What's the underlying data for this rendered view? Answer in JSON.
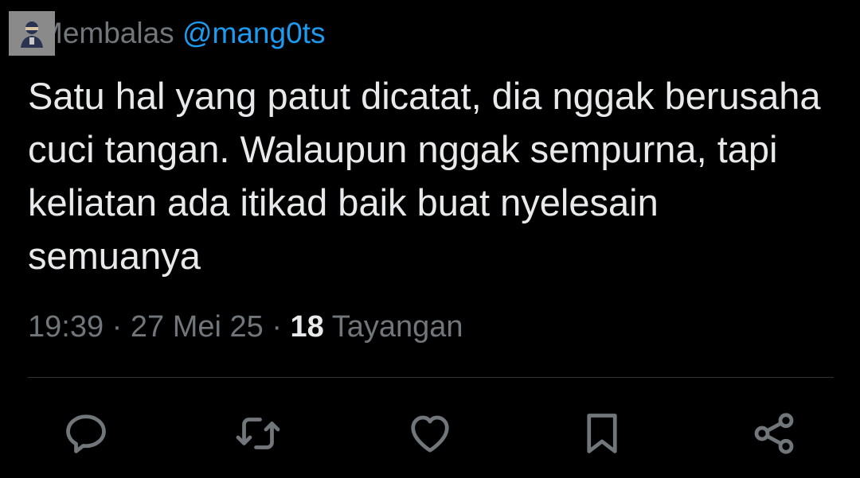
{
  "reply": {
    "prefix": "Membalas",
    "handle": "@mang0ts"
  },
  "avatar": {
    "icon": "avatar-icon"
  },
  "tweet": {
    "text": "Satu hal yang patut dicatat, dia nggak berusaha cuci tangan. Walaupun nggak sempurna, tapi keliatan ada itikad baik buat nyelesain semuanya"
  },
  "meta": {
    "time": "19:39",
    "separator1": " · ",
    "date": "27 Mei 25",
    "separator2": " · ",
    "views_count": "18",
    "views_label": " Tayangan"
  },
  "actions": [
    {
      "name": "reply",
      "icon": "reply-icon"
    },
    {
      "name": "retweet",
      "icon": "retweet-icon"
    },
    {
      "name": "like",
      "icon": "heart-icon"
    },
    {
      "name": "bookmark",
      "icon": "bookmark-icon"
    },
    {
      "name": "share",
      "icon": "share-icon"
    }
  ],
  "colors": {
    "background": "#000000",
    "text": "#e7e9ea",
    "secondary": "#71767b",
    "link": "#1d9bf0",
    "divider": "#2f3336"
  }
}
